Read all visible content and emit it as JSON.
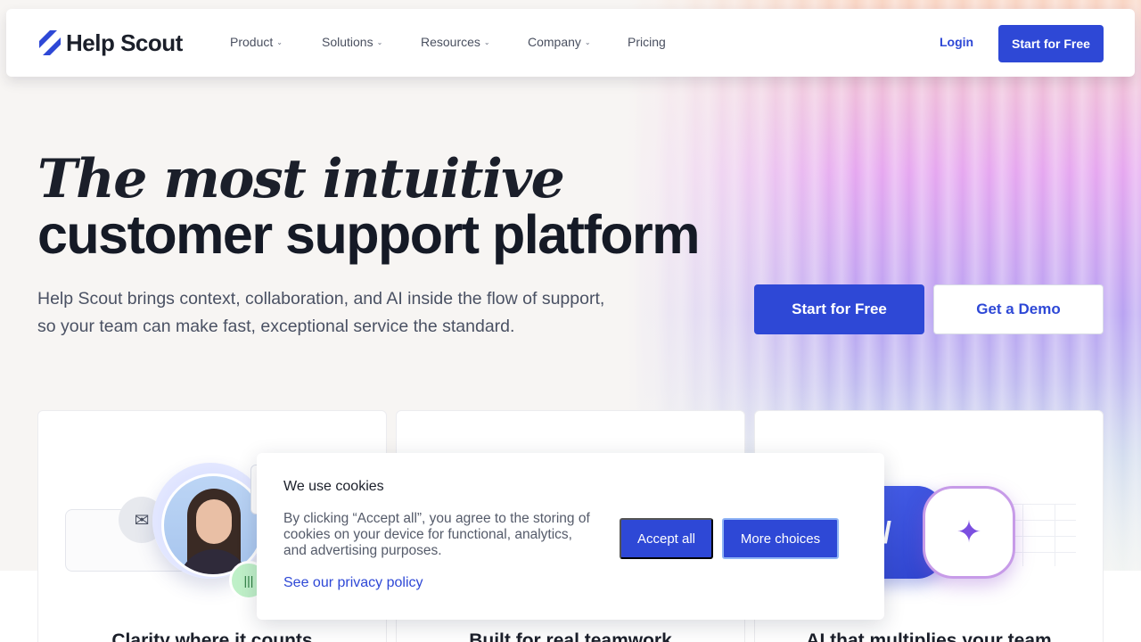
{
  "nav": {
    "brand": "Help Scout",
    "links": [
      {
        "label": "Product",
        "chevron": true
      },
      {
        "label": "Solutions",
        "chevron": true
      },
      {
        "label": "Resources",
        "chevron": true
      },
      {
        "label": "Company",
        "chevron": true
      },
      {
        "label": "Pricing",
        "chevron": false
      }
    ],
    "login": "Login",
    "cta": "Start for Free"
  },
  "hero": {
    "title_italic": "The most intuitive",
    "title_bold": "customer support platform",
    "subtitle": "Help Scout brings context, collaboration, and AI inside the flow of support, so your team can make fast, exceptional service the standard.",
    "primary_cta": "Start for Free",
    "secondary_cta": "Get a Demo"
  },
  "cards": [
    {
      "title": "Clarity where it counts"
    },
    {
      "title": "Built for real teamwork"
    },
    {
      "title": "AI that multiplies your team"
    }
  ],
  "cookie": {
    "title": "We use cookies",
    "body": "By clicking “Accept all”, you agree to the storing of cookies on your device for functional, analytics, and advertising purposes.",
    "privacy_link": "See our privacy policy",
    "accept": "Accept all",
    "more": "More choices"
  },
  "colors": {
    "accent": "#2e48d6",
    "text": "#1b1f2a"
  }
}
